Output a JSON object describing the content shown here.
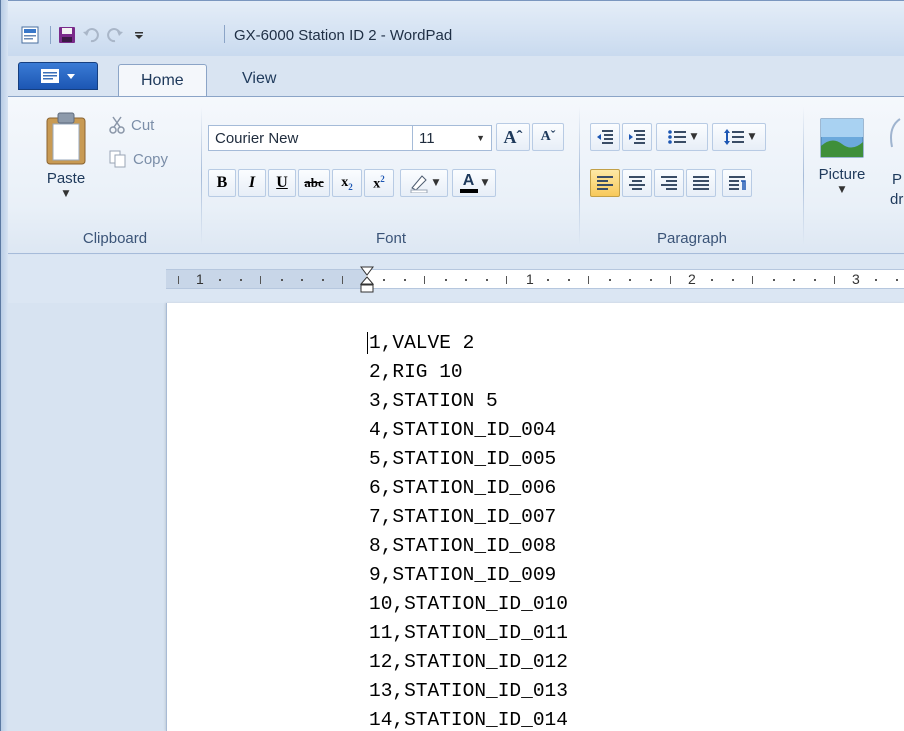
{
  "window": {
    "title": "GX-6000 Station ID 2 - WordPad"
  },
  "tabs": [
    {
      "label": "Home",
      "active": true
    },
    {
      "label": "View",
      "active": false
    }
  ],
  "ribbon": {
    "clipboard": {
      "group_label": "Clipboard",
      "paste_label": "Paste",
      "cut_label": "Cut",
      "copy_label": "Copy"
    },
    "font": {
      "group_label": "Font",
      "font_family": "Courier New",
      "font_size": "11"
    },
    "paragraph": {
      "group_label": "Paragraph"
    },
    "insert": {
      "picture_label": "Picture",
      "partial_label_top": "P",
      "partial_label_bottom": "dr"
    }
  },
  "ruler": {
    "labels": [
      "1",
      "1",
      "2",
      "3"
    ]
  },
  "document": {
    "lines": [
      "1,VALVE 2",
      "2,RIG 10",
      "3,STATION 5",
      "4,STATION_ID_004",
      "5,STATION_ID_005",
      "6,STATION_ID_006",
      "7,STATION_ID_007",
      "8,STATION_ID_008",
      "9,STATION_ID_009",
      "10,STATION_ID_010",
      "11,STATION_ID_011",
      "12,STATION_ID_012",
      "13,STATION_ID_013",
      "14,STATION_ID_014"
    ]
  },
  "colors": {
    "accent": "#1c56b3",
    "selected": "#f8c95b",
    "font_color": "#000000"
  }
}
